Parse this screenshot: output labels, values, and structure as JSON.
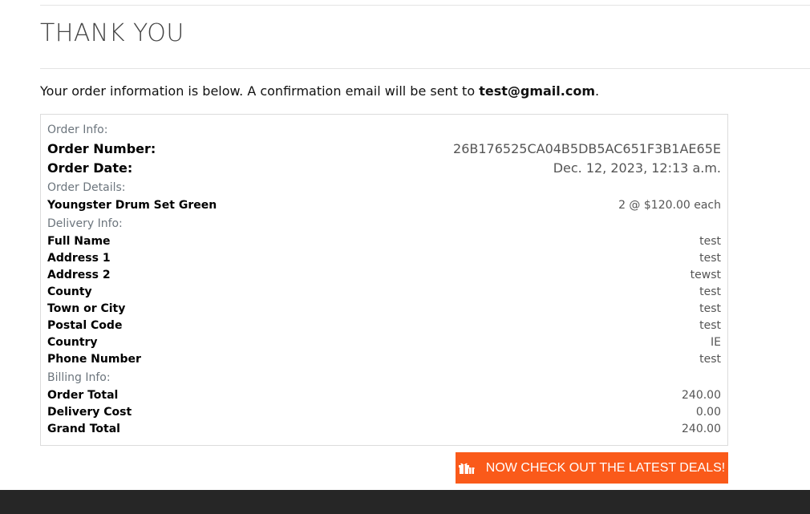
{
  "page": {
    "title": "THANK YOU",
    "intro_text": "Your order information is below. A confirmation email will be sent to ",
    "email": "test@gmail.com",
    "intro_end": "."
  },
  "order_info": {
    "section_label": "Order Info:",
    "order_number_label": "Order Number:",
    "order_number": "26B176525CA04B5DB5AC651F3B1AE65E",
    "order_date_label": "Order Date:",
    "order_date": "Dec. 12, 2023, 12:13 a.m."
  },
  "order_details": {
    "section_label": "Order Details:",
    "items": [
      {
        "name": "Youngster Drum Set Green",
        "qty_price": "2 @ $120.00 each"
      }
    ]
  },
  "delivery_info": {
    "section_label": "Delivery Info:",
    "fields": [
      {
        "label": "Full Name",
        "value": "test"
      },
      {
        "label": "Address 1",
        "value": "test"
      },
      {
        "label": "Address 2",
        "value": "tewst"
      },
      {
        "label": "County",
        "value": "test"
      },
      {
        "label": "Town or City",
        "value": "test"
      },
      {
        "label": "Postal Code",
        "value": "test"
      },
      {
        "label": "Country",
        "value": "IE"
      },
      {
        "label": "Phone Number",
        "value": "test"
      }
    ]
  },
  "billing_info": {
    "section_label": "Billing Info:",
    "fields": [
      {
        "label": "Order Total",
        "value": "240.00"
      },
      {
        "label": "Delivery Cost",
        "value": "0.00"
      },
      {
        "label": "Grand Total",
        "value": "240.00"
      }
    ]
  },
  "cta": {
    "label": "NOW CHECK OUT THE LATEST DEALS!",
    "icon": "gifts-icon",
    "color": "#fa5a1a"
  },
  "colors": {
    "footer": "#262626",
    "section_label": "#6c757d"
  }
}
